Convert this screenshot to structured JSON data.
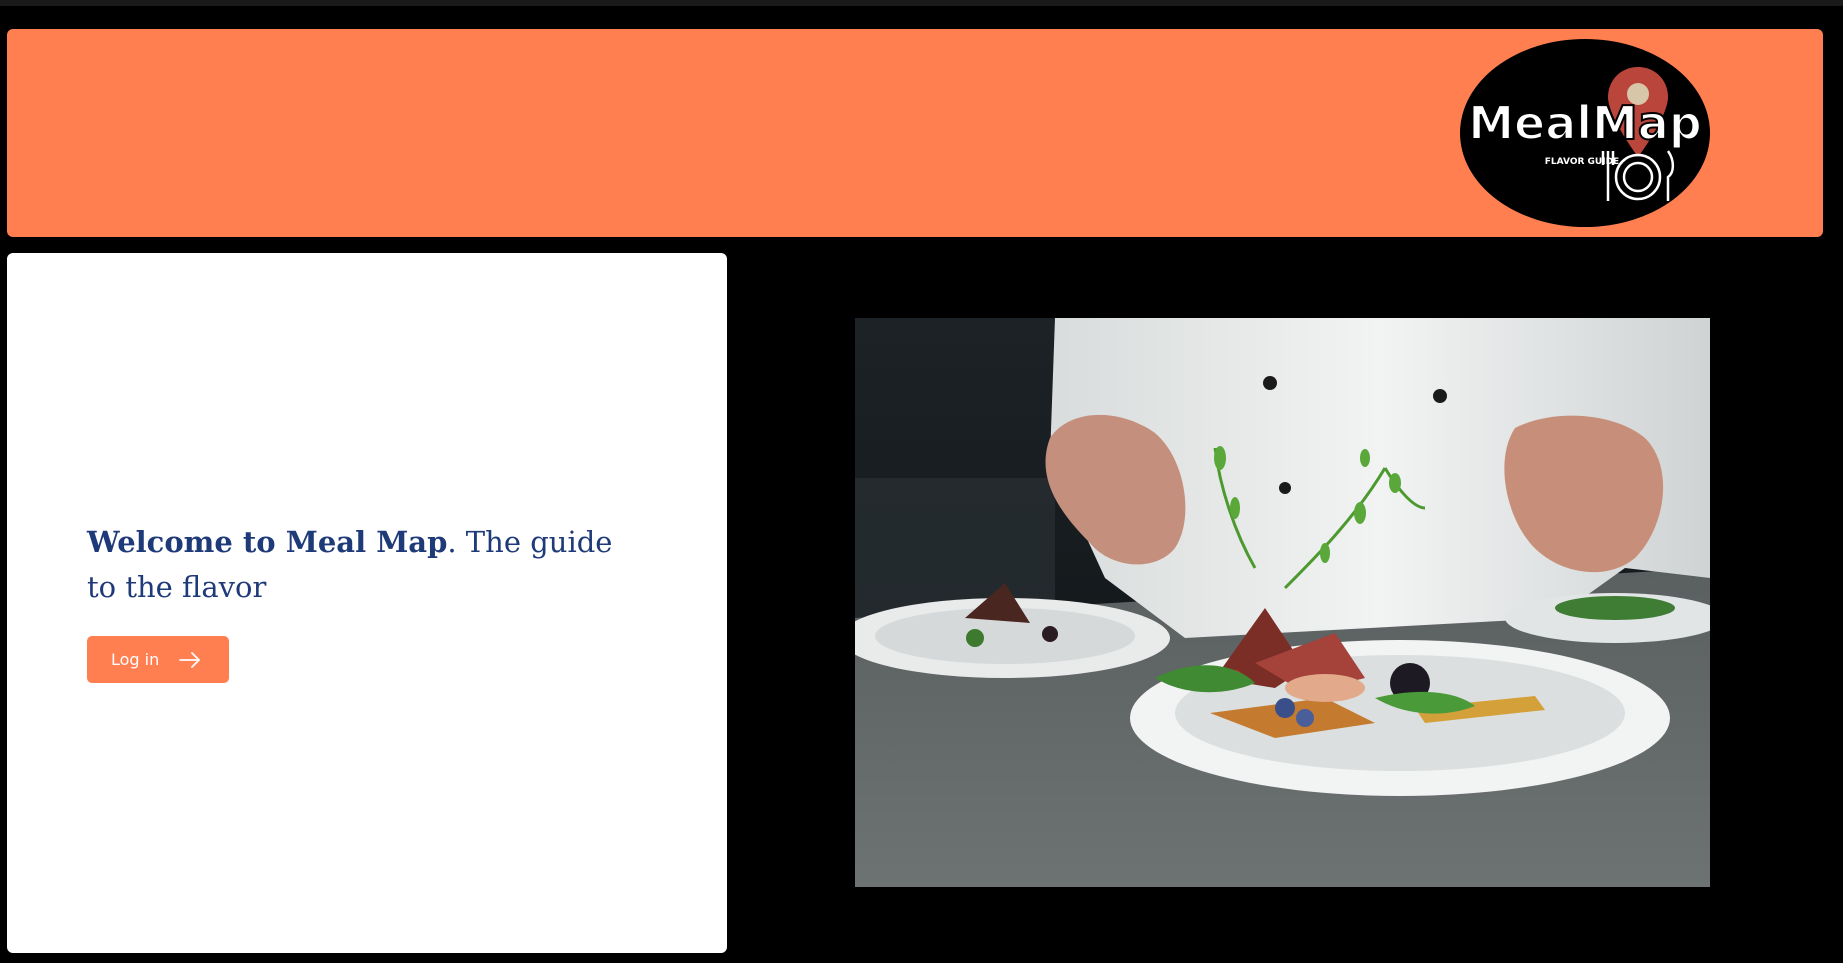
{
  "header": {
    "logo": {
      "wordmark": "MealMap",
      "tagline": "FLAVOR GUIDE",
      "icon": "map-pin-plate-icon"
    },
    "colors": {
      "accent": "#ff7f50",
      "background": "#000000",
      "heading": "#1f3a78"
    }
  },
  "welcome": {
    "heading_strong": "Welcome to Meal Map",
    "heading_rest": ". The guide to the flavor",
    "login_label": "Log in",
    "login_icon": "arrow-right-icon"
  },
  "hero": {
    "image": "chef-plating-dish-photo"
  }
}
